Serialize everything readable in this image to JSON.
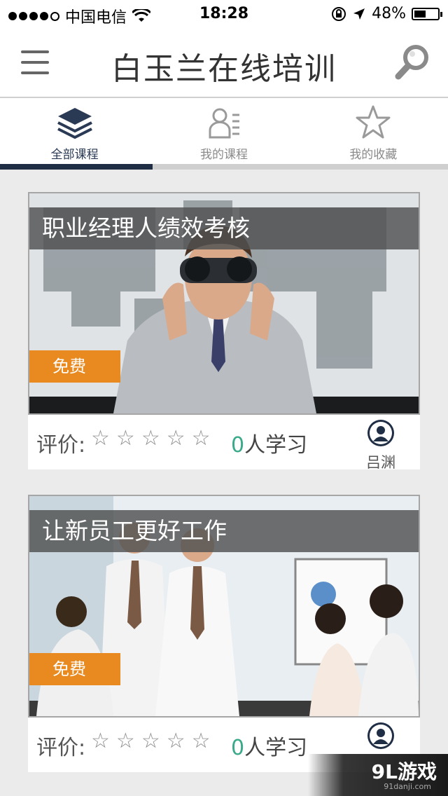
{
  "status_bar": {
    "carrier": "中国电信",
    "time": "18:28",
    "battery": "48%",
    "battery_level": 0.48
  },
  "header": {
    "title": "白玉兰在线培训",
    "menu_icon": "hamburger-menu-icon",
    "search_icon": "magnifier-icon"
  },
  "tabs": [
    {
      "label": "全部课程",
      "icon": "layers-icon",
      "active": true
    },
    {
      "label": "我的课程",
      "icon": "user-list-icon",
      "active": false
    },
    {
      "label": "我的收藏",
      "icon": "star-outline-icon",
      "active": false
    }
  ],
  "courses": [
    {
      "title": "职业经理人绩效考核",
      "badge": "免费",
      "rating_label": "评价:",
      "rating": 0,
      "learner_count": "0",
      "learner_suffix": "人学习",
      "teacher": "吕渊"
    },
    {
      "title": "让新员工更好工作",
      "badge": "免费",
      "rating_label": "评价:",
      "rating": 0,
      "learner_count": "0",
      "learner_suffix": "人学习",
      "teacher": ""
    }
  ],
  "watermark": {
    "logo": "9L游戏",
    "url": "91danji.com"
  },
  "colors": {
    "accent": "#1f2d45",
    "badge": "#e88a1f",
    "count": "#3aaa8a",
    "background": "#ebebeb"
  }
}
